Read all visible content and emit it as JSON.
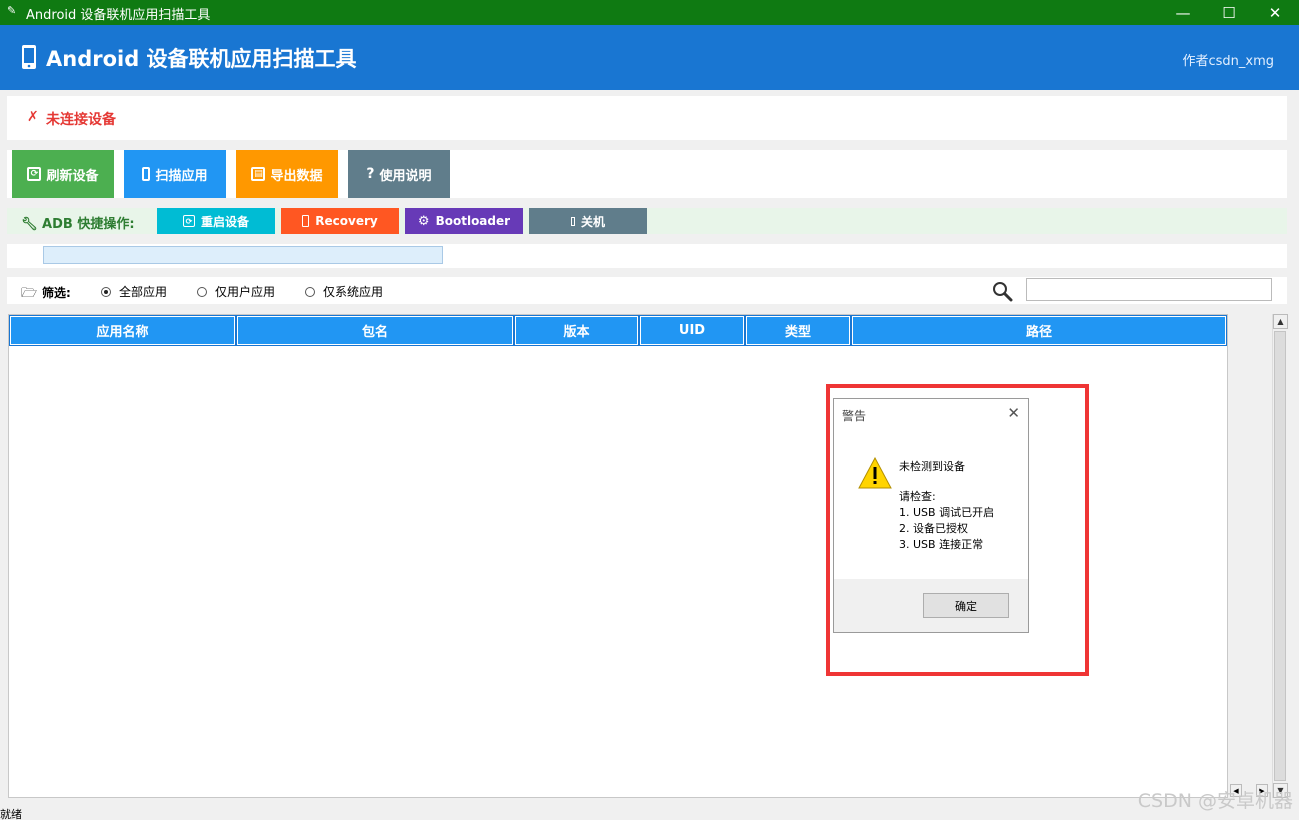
{
  "window": {
    "title": "Android 设备联机应用扫描工具",
    "controls": {
      "minimize": "—",
      "maximize": "☐",
      "close": "✕"
    }
  },
  "header": {
    "title": "Android 设备联机应用扫描工具",
    "author": "作者csdn_xmg",
    "icon": "phone-icon"
  },
  "status": {
    "mark": "✗",
    "text": "未连接设备",
    "color": "#e53935"
  },
  "toolbar": {
    "refresh": "刷新设备",
    "scan": "扫描应用",
    "export": "导出数据",
    "help": "使用说明"
  },
  "adb": {
    "label": "ADB 快捷操作:",
    "reboot": "重启设备",
    "recovery": "Recovery",
    "bootloader": "Bootloader",
    "shutdown": "关机"
  },
  "filter": {
    "label": "筛选:",
    "options": [
      "全部应用",
      "仅用户应用",
      "仅系统应用"
    ],
    "selected": "全部应用",
    "search_value": ""
  },
  "table": {
    "columns": [
      "应用名称",
      "包名",
      "版本",
      "UID",
      "类型",
      "路径"
    ],
    "rows": []
  },
  "dialog": {
    "title": "警告",
    "close": "✕",
    "heading": "未检测到设备",
    "check": "请检查:",
    "items": [
      "1. USB 调试已开启",
      "2. 设备已授权",
      "3. USB 连接正常"
    ],
    "ok": "确定",
    "icon": "warning-icon"
  },
  "statusbar": {
    "text": "就绪"
  },
  "watermark": "CSDN @安卓机器",
  "colors": {
    "titlebar": "#0f7a12",
    "header": "#1976d2",
    "refresh": "#4caf50",
    "scan": "#2196f3",
    "export": "#ff9800",
    "help": "#607d8b",
    "reboot": "#00bcd4",
    "recovery": "#ff5722",
    "bootloader": "#673ab7",
    "shutdown": "#607d8b",
    "table_header": "#2196f3",
    "highlight": "#ef3535"
  }
}
